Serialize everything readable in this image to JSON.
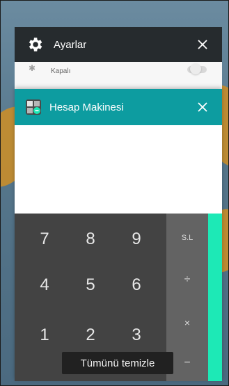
{
  "settings_card": {
    "title": "Ayarlar",
    "icon": "gear-icon",
    "close_icon": "close-icon",
    "row_status": "Kapalı"
  },
  "calculator_card": {
    "title": "Hesap Makinesi",
    "icon": "calculator-icon",
    "close_icon": "close-icon",
    "keys": [
      "7",
      "8",
      "9",
      "4",
      "5",
      "6",
      "1",
      "2",
      "3"
    ],
    "ops": [
      "S.L",
      "÷",
      "×",
      "−"
    ]
  },
  "clear_all_label": "Tümünü temizle",
  "colors": {
    "settings_header": "#262b2e",
    "calc_header": "#0d9ca0",
    "keypad": "#434343",
    "ops_column": "#636363",
    "accent_strip": "#1de9b6"
  }
}
